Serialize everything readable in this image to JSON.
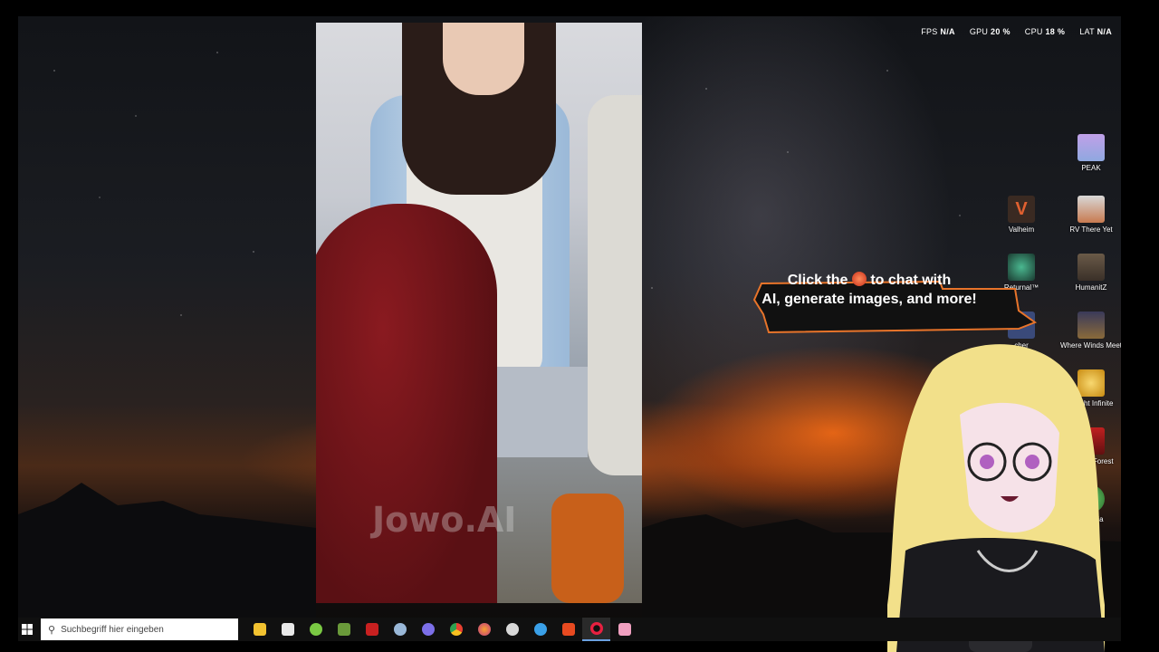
{
  "stats": [
    {
      "label": "FPS",
      "value": "N/A"
    },
    {
      "label": "GPU",
      "value": "20 %"
    },
    {
      "label": "CPU",
      "value": "18 %"
    },
    {
      "label": "LAT",
      "value": "N/A"
    }
  ],
  "video": {
    "watermark": "Jowo.AI"
  },
  "desktop_icons": [
    {
      "label": "PEAK",
      "icon": "peak-icon",
      "color": "#9aa0e0"
    },
    {
      "label": "Valheim",
      "icon": "valheim-icon",
      "color": "#3a2a22"
    },
    {
      "label": "RV There Yet",
      "icon": "rv-there-yet-icon",
      "color": "#c87a50"
    },
    {
      "label": "Returnal™",
      "icon": "returnal-icon",
      "color": "#2a6a55"
    },
    {
      "label": "HumanitZ",
      "icon": "humanitz-icon",
      "color": "#5a4a3a"
    },
    {
      "label": "cher",
      "icon": "launcher-icon",
      "color": "#3a4a7a"
    },
    {
      "label": "Where Winds Meet",
      "icon": "where-winds-meet-icon",
      "color": "#8a6a3a"
    },
    {
      "label": "chlight Infinite",
      "icon": "torchlight-icon",
      "color": "#d8a020"
    },
    {
      "label": "Of The Forest",
      "icon": "sons-of-the-forest-icon",
      "color": "#b02020"
    },
    {
      "label": "Terraria",
      "icon": "terraria-icon",
      "color": "#3a8a3a"
    }
  ],
  "tooltip": {
    "line1_before": "Click the",
    "line1_after": "to chat with",
    "line2": "AI, generate images, and more!"
  },
  "taskbar": {
    "search_placeholder": "Suchbegriff hier eingeben",
    "apps": [
      {
        "icon": "file-explorer-icon",
        "color": "#f2c230"
      },
      {
        "icon": "store-icon",
        "color": "#e8e8e8"
      },
      {
        "icon": "android-icon",
        "color": "#7ac943"
      },
      {
        "icon": "minecraft-icon",
        "color": "#6a9a3a"
      },
      {
        "icon": "media-icon",
        "color": "#c82020"
      },
      {
        "icon": "steam-icon",
        "color": "#9ab8d8"
      },
      {
        "icon": "discord-icon",
        "color": "#7c6fe8"
      },
      {
        "icon": "chrome-icon",
        "color": "#e8b020"
      },
      {
        "icon": "firefox-icon",
        "color": "#e86a20"
      },
      {
        "icon": "speedometer-icon",
        "color": "#d8d8d8"
      },
      {
        "icon": "app-icon",
        "color": "#3aa0e8"
      },
      {
        "icon": "brave-icon",
        "color": "#e84a20"
      },
      {
        "icon": "opera-icon",
        "color": "#e82040"
      },
      {
        "icon": "heart-app-icon",
        "color": "#f0a0c0"
      }
    ]
  }
}
